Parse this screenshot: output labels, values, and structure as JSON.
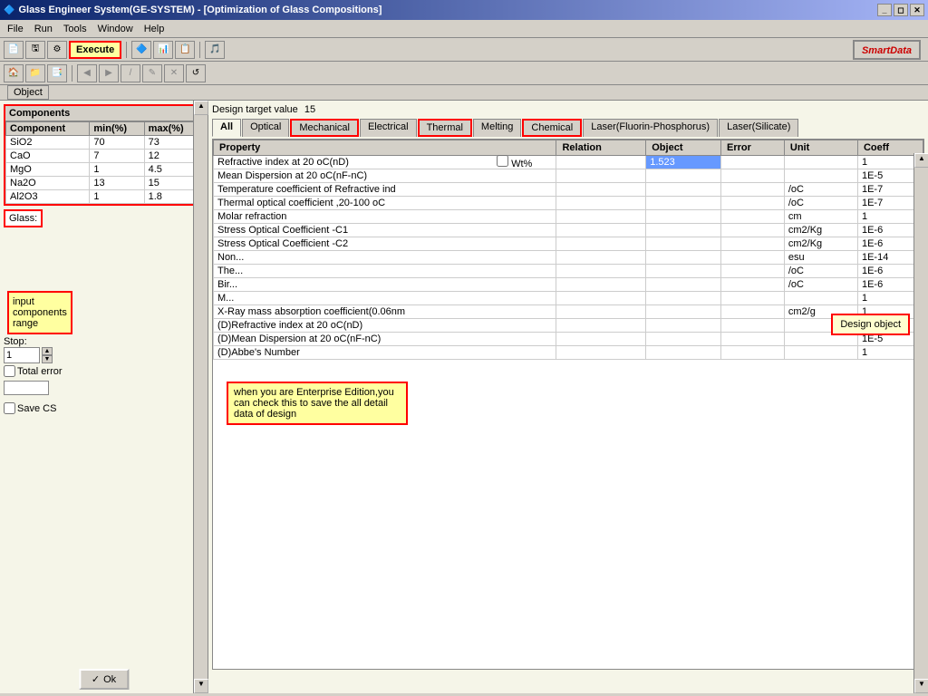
{
  "window": {
    "title": "Glass Engineer System(GE-SYSTEM) - [Optimization of Glass Compositions]",
    "icon": "ge-icon"
  },
  "menu": {
    "items": [
      "File",
      "Run",
      "Tools",
      "Window",
      "Help"
    ]
  },
  "toolbar": {
    "execute_label": "Execute",
    "smartdata_label": "SmartData"
  },
  "object_label": "Object",
  "left_panel": {
    "components_title": "Components",
    "columns": [
      "Component",
      "min(%)",
      "max(%)"
    ],
    "rows": [
      [
        "SiO2",
        "70",
        "73"
      ],
      [
        "CaO",
        "7",
        "12"
      ],
      [
        "MgO",
        "1",
        "4.5"
      ],
      [
        "Na2O",
        "13",
        "15"
      ],
      [
        "Al2O3",
        "1",
        "1.8"
      ]
    ],
    "glass_label": "Glass:",
    "input_components_range": "input\ncomponents\nrange",
    "stop_label": "Stop:",
    "stop_value": "1",
    "total_error_label": "Total error",
    "save_label": "Save CS",
    "ok_label": "Ok",
    "checkmark": "✓"
  },
  "right_panel": {
    "design_target_label": "Design target value",
    "design_target_value": "15",
    "tabs": [
      {
        "label": "All",
        "active": true
      },
      {
        "label": "Optical"
      },
      {
        "label": "Mechanical",
        "highlighted": true
      },
      {
        "label": "Electrical"
      },
      {
        "label": "Thermal",
        "highlighted": true
      },
      {
        "label": "Melting"
      },
      {
        "label": "Chemical",
        "highlighted": true
      },
      {
        "label": "Laser(Fluorin-Phosphorus)"
      },
      {
        "label": "Laser(Silicate)"
      }
    ],
    "table": {
      "columns": [
        "Property",
        "Relation",
        "Object",
        "Error",
        "Unit",
        "Coeff"
      ],
      "rows": [
        {
          "property": "Refractive index at 20 oC(nD)",
          "relation": "",
          "object": "1.523",
          "error": "",
          "unit": "",
          "coeff": "1",
          "object_highlight": true
        },
        {
          "property": "Mean Dispersion  at 20 oC(nF-nC)",
          "relation": "",
          "object": "",
          "error": "",
          "unit": "",
          "coeff": "1E-5"
        },
        {
          "property": "Temperature coefficient of Refractive ind",
          "relation": "",
          "object": "",
          "error": "",
          "unit": "/oC",
          "coeff": "1E-7"
        },
        {
          "property": "Thermal optical coefficient ,20-100 oC",
          "relation": "",
          "object": "",
          "error": "",
          "unit": "/oC",
          "coeff": "1E-7"
        },
        {
          "property": "Molar refraction",
          "relation": "",
          "object": "",
          "error": "",
          "unit": "cm",
          "coeff": "1"
        },
        {
          "property": "Stress Optical Coefficient -C1",
          "relation": "",
          "object": "",
          "error": "",
          "unit": "cm2/Kg",
          "coeff": "1E-6"
        },
        {
          "property": "Stress Optical Coefficient -C2",
          "relation": "",
          "object": "",
          "error": "",
          "unit": "cm2/Kg",
          "coeff": "1E-6"
        },
        {
          "property": "Non...",
          "relation": "",
          "object": "",
          "error": "",
          "unit": "esu",
          "coeff": "1E-14"
        },
        {
          "property": "The...",
          "relation": "",
          "object": "",
          "error": "",
          "unit": "/oC",
          "coeff": "1E-6"
        },
        {
          "property": "Bir...",
          "relation": "",
          "object": "",
          "error": "",
          "unit": "/oC",
          "coeff": "1E-6"
        },
        {
          "property": "M...",
          "relation": "",
          "object": "",
          "error": "",
          "unit": "",
          "coeff": "1"
        },
        {
          "property": "X-Ray mass absorption coefficient(0.06nm",
          "relation": "",
          "object": "",
          "error": "",
          "unit": "cm2/g",
          "coeff": "1"
        },
        {
          "property": "(D)Refractive index at 20 oC(nD)",
          "relation": "",
          "object": "",
          "error": "",
          "unit": "",
          "coeff": "1"
        },
        {
          "property": "(D)Mean Dispersion  at 20 oC(nF-nC)",
          "relation": "",
          "object": "",
          "error": "",
          "unit": "",
          "coeff": "1E-5"
        },
        {
          "property": "(D)Abbe's Number",
          "relation": "",
          "object": "",
          "error": "",
          "unit": "",
          "coeff": "1"
        }
      ]
    }
  },
  "tooltips": {
    "enterprise_edition": "when you are Enterprise Edition,you\ncan check this to save the all detail\ndata of design",
    "design_object": "Design object"
  }
}
